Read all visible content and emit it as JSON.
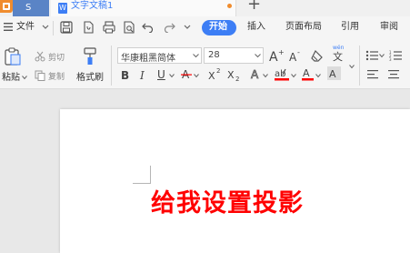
{
  "tabs": {
    "left_tab": "S",
    "doc_tab": "文字文稿1",
    "new_tab": "+"
  },
  "menu": {
    "file": "文件",
    "items": [
      "开始",
      "插入",
      "页面布局",
      "引用",
      "审阅"
    ],
    "active": "开始"
  },
  "toolbar": {
    "paste": "粘贴",
    "cut": "剪切",
    "copy": "复制",
    "format_painter": "格式刷",
    "font_name": "华康粗黑简体",
    "font_size": "28",
    "wen_icon_label": "wén",
    "wen_char": "文"
  },
  "document": {
    "text": "给我设置投影",
    "text_color": "#ff0000"
  },
  "colors": {
    "accent": "#3d7ef5",
    "red": "#ff0000",
    "orange": "#f08c2e"
  }
}
